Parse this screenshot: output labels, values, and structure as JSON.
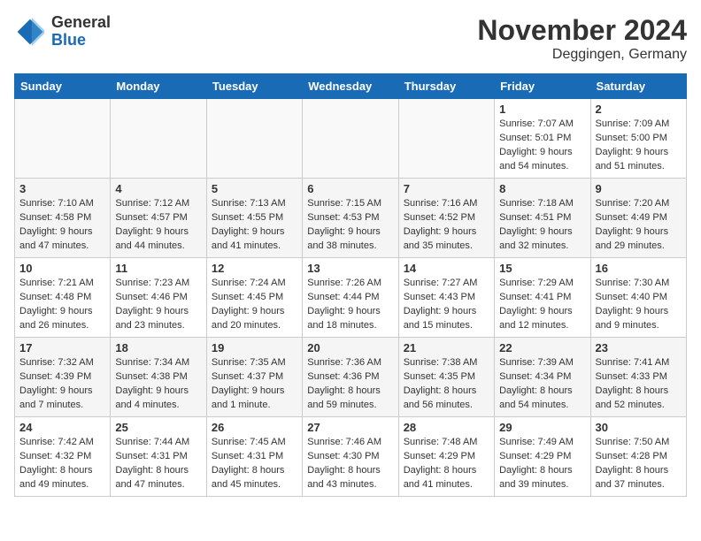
{
  "header": {
    "logo_general": "General",
    "logo_blue": "Blue",
    "month_title": "November 2024",
    "location": "Deggingen, Germany"
  },
  "weekdays": [
    "Sunday",
    "Monday",
    "Tuesday",
    "Wednesday",
    "Thursday",
    "Friday",
    "Saturday"
  ],
  "weeks": [
    [
      {
        "day": "",
        "info": ""
      },
      {
        "day": "",
        "info": ""
      },
      {
        "day": "",
        "info": ""
      },
      {
        "day": "",
        "info": ""
      },
      {
        "day": "",
        "info": ""
      },
      {
        "day": "1",
        "info": "Sunrise: 7:07 AM\nSunset: 5:01 PM\nDaylight: 9 hours and 54 minutes."
      },
      {
        "day": "2",
        "info": "Sunrise: 7:09 AM\nSunset: 5:00 PM\nDaylight: 9 hours and 51 minutes."
      }
    ],
    [
      {
        "day": "3",
        "info": "Sunrise: 7:10 AM\nSunset: 4:58 PM\nDaylight: 9 hours and 47 minutes."
      },
      {
        "day": "4",
        "info": "Sunrise: 7:12 AM\nSunset: 4:57 PM\nDaylight: 9 hours and 44 minutes."
      },
      {
        "day": "5",
        "info": "Sunrise: 7:13 AM\nSunset: 4:55 PM\nDaylight: 9 hours and 41 minutes."
      },
      {
        "day": "6",
        "info": "Sunrise: 7:15 AM\nSunset: 4:53 PM\nDaylight: 9 hours and 38 minutes."
      },
      {
        "day": "7",
        "info": "Sunrise: 7:16 AM\nSunset: 4:52 PM\nDaylight: 9 hours and 35 minutes."
      },
      {
        "day": "8",
        "info": "Sunrise: 7:18 AM\nSunset: 4:51 PM\nDaylight: 9 hours and 32 minutes."
      },
      {
        "day": "9",
        "info": "Sunrise: 7:20 AM\nSunset: 4:49 PM\nDaylight: 9 hours and 29 minutes."
      }
    ],
    [
      {
        "day": "10",
        "info": "Sunrise: 7:21 AM\nSunset: 4:48 PM\nDaylight: 9 hours and 26 minutes."
      },
      {
        "day": "11",
        "info": "Sunrise: 7:23 AM\nSunset: 4:46 PM\nDaylight: 9 hours and 23 minutes."
      },
      {
        "day": "12",
        "info": "Sunrise: 7:24 AM\nSunset: 4:45 PM\nDaylight: 9 hours and 20 minutes."
      },
      {
        "day": "13",
        "info": "Sunrise: 7:26 AM\nSunset: 4:44 PM\nDaylight: 9 hours and 18 minutes."
      },
      {
        "day": "14",
        "info": "Sunrise: 7:27 AM\nSunset: 4:43 PM\nDaylight: 9 hours and 15 minutes."
      },
      {
        "day": "15",
        "info": "Sunrise: 7:29 AM\nSunset: 4:41 PM\nDaylight: 9 hours and 12 minutes."
      },
      {
        "day": "16",
        "info": "Sunrise: 7:30 AM\nSunset: 4:40 PM\nDaylight: 9 hours and 9 minutes."
      }
    ],
    [
      {
        "day": "17",
        "info": "Sunrise: 7:32 AM\nSunset: 4:39 PM\nDaylight: 9 hours and 7 minutes."
      },
      {
        "day": "18",
        "info": "Sunrise: 7:34 AM\nSunset: 4:38 PM\nDaylight: 9 hours and 4 minutes."
      },
      {
        "day": "19",
        "info": "Sunrise: 7:35 AM\nSunset: 4:37 PM\nDaylight: 9 hours and 1 minute."
      },
      {
        "day": "20",
        "info": "Sunrise: 7:36 AM\nSunset: 4:36 PM\nDaylight: 8 hours and 59 minutes."
      },
      {
        "day": "21",
        "info": "Sunrise: 7:38 AM\nSunset: 4:35 PM\nDaylight: 8 hours and 56 minutes."
      },
      {
        "day": "22",
        "info": "Sunrise: 7:39 AM\nSunset: 4:34 PM\nDaylight: 8 hours and 54 minutes."
      },
      {
        "day": "23",
        "info": "Sunrise: 7:41 AM\nSunset: 4:33 PM\nDaylight: 8 hours and 52 minutes."
      }
    ],
    [
      {
        "day": "24",
        "info": "Sunrise: 7:42 AM\nSunset: 4:32 PM\nDaylight: 8 hours and 49 minutes."
      },
      {
        "day": "25",
        "info": "Sunrise: 7:44 AM\nSunset: 4:31 PM\nDaylight: 8 hours and 47 minutes."
      },
      {
        "day": "26",
        "info": "Sunrise: 7:45 AM\nSunset: 4:31 PM\nDaylight: 8 hours and 45 minutes."
      },
      {
        "day": "27",
        "info": "Sunrise: 7:46 AM\nSunset: 4:30 PM\nDaylight: 8 hours and 43 minutes."
      },
      {
        "day": "28",
        "info": "Sunrise: 7:48 AM\nSunset: 4:29 PM\nDaylight: 8 hours and 41 minutes."
      },
      {
        "day": "29",
        "info": "Sunrise: 7:49 AM\nSunset: 4:29 PM\nDaylight: 8 hours and 39 minutes."
      },
      {
        "day": "30",
        "info": "Sunrise: 7:50 AM\nSunset: 4:28 PM\nDaylight: 8 hours and 37 minutes."
      }
    ]
  ]
}
